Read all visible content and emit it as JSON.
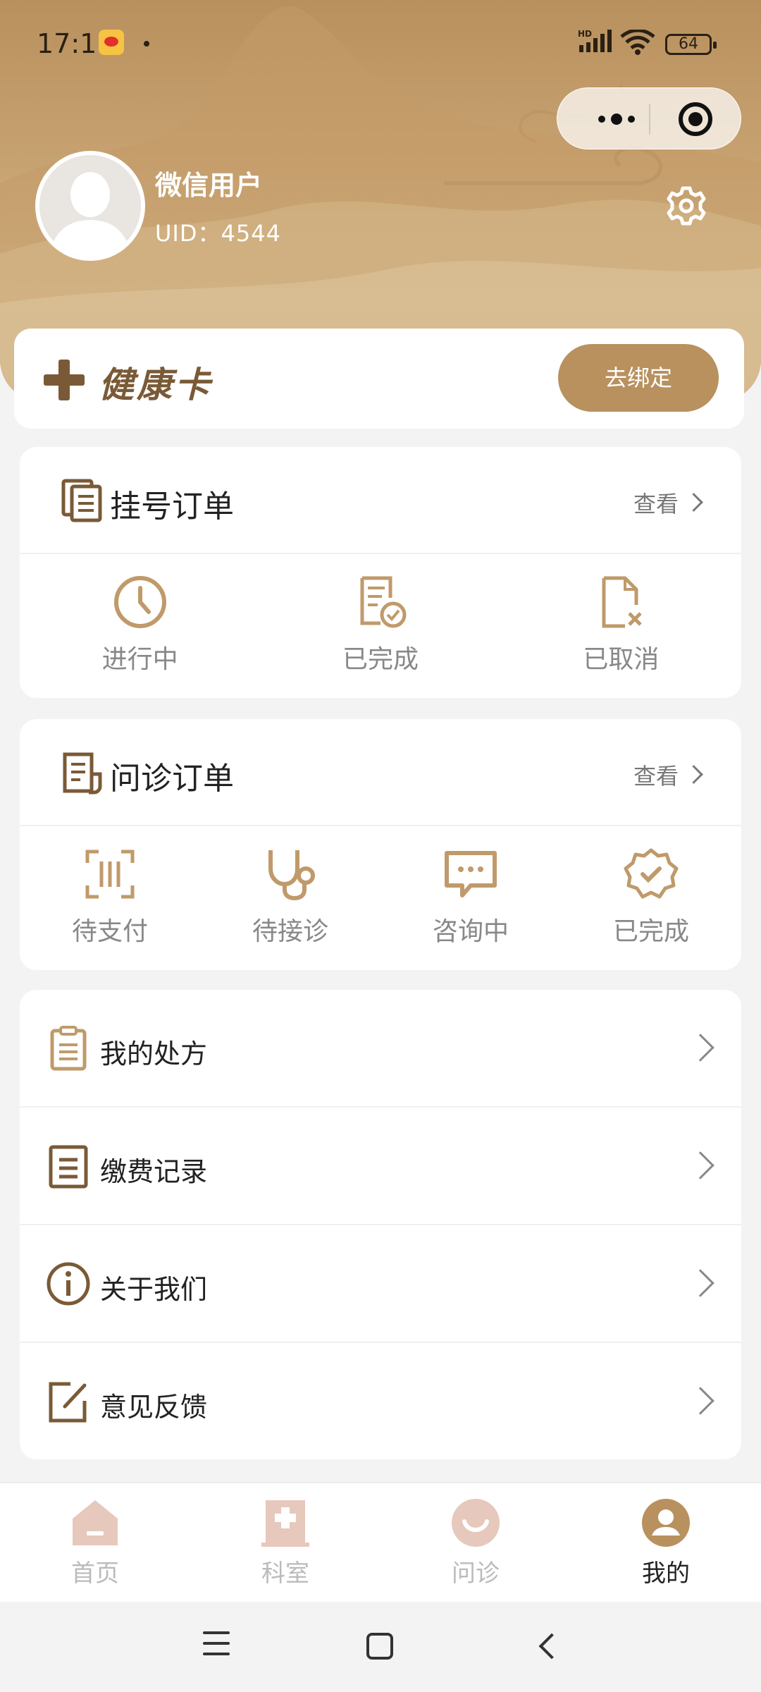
{
  "status_bar": {
    "time": "17:11",
    "network": "HD",
    "battery": "64"
  },
  "profile": {
    "name": "微信用户",
    "uid": "UID：4544"
  },
  "health_card": {
    "title": "健康卡",
    "bind_label": "去绑定"
  },
  "registration_orders": {
    "title": "挂号订单",
    "view_label": "查看",
    "items": [
      {
        "label": "进行中",
        "icon": "clock-icon"
      },
      {
        "label": "已完成",
        "icon": "document-check-icon"
      },
      {
        "label": "已取消",
        "icon": "document-cancel-icon"
      }
    ]
  },
  "consult_orders": {
    "title": "问诊订单",
    "view_label": "查看",
    "items": [
      {
        "label": "待支付",
        "icon": "scan-pay-icon"
      },
      {
        "label": "待接诊",
        "icon": "stethoscope-icon"
      },
      {
        "label": "咨询中",
        "icon": "chat-icon"
      },
      {
        "label": "已完成",
        "icon": "verified-badge-icon"
      }
    ]
  },
  "menu": [
    {
      "label": "我的处方",
      "icon": "clipboard-icon"
    },
    {
      "label": "缴费记录",
      "icon": "receipt-icon"
    },
    {
      "label": "关于我们",
      "icon": "info-icon"
    },
    {
      "label": "意见反馈",
      "icon": "edit-icon"
    }
  ],
  "tabbar": [
    {
      "label": "首页",
      "icon": "home-icon",
      "active": false
    },
    {
      "label": "科室",
      "icon": "hospital-icon",
      "active": false
    },
    {
      "label": "问诊",
      "icon": "consult-icon",
      "active": false
    },
    {
      "label": "我的",
      "icon": "user-icon",
      "active": true
    }
  ],
  "colors": {
    "accent": "#b8915f",
    "accent_dark": "#7a5a36",
    "background": "#f3f3f3"
  }
}
